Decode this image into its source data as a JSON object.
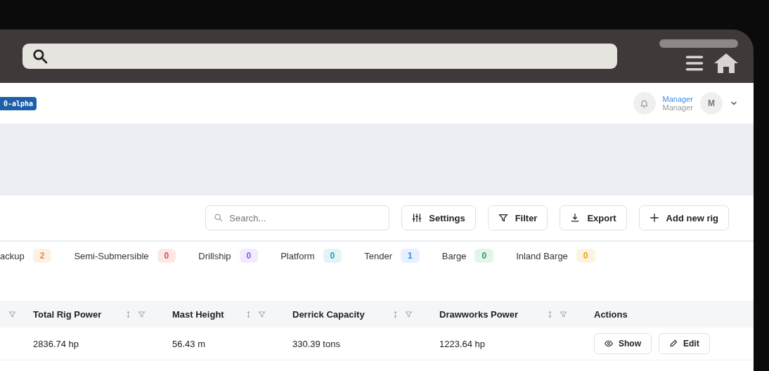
{
  "header": {
    "version_badge": "0-alpha",
    "user_name": "Manager",
    "user_role": "Manager",
    "avatar": "M"
  },
  "toolbar": {
    "search": {
      "placeholder": "Search..."
    },
    "buttons": [
      {
        "kind": "settings",
        "label": "Settings"
      },
      {
        "kind": "filter",
        "label": "Filter"
      },
      {
        "kind": "export",
        "label": "Export"
      },
      {
        "kind": "add",
        "label": "Add new rig"
      }
    ]
  },
  "tabs": [
    {
      "label": "ackup",
      "count": "2",
      "color": "#f08c2e"
    },
    {
      "label": "Semi-Submersible",
      "count": "0",
      "color": "#ef4444"
    },
    {
      "label": "Drillship",
      "count": "0",
      "color": "#8b5cf6"
    },
    {
      "label": "Platform",
      "count": "0",
      "color": "#14a3b8"
    },
    {
      "label": "Tender",
      "count": "1",
      "color": "#3b82f6"
    },
    {
      "label": "Barge",
      "count": "0",
      "color": "#22a355"
    },
    {
      "label": "Inland Barge",
      "count": "0",
      "color": "#e5a50a"
    }
  ],
  "table": {
    "columns": [
      {
        "kind": "filter"
      },
      {
        "label": "Total Rig Power",
        "kind": "sortable"
      },
      {
        "label": "Mast Height",
        "kind": "sortable"
      },
      {
        "label": "Derrick Capacity",
        "kind": "sortable"
      },
      {
        "label": "Drawworks Power",
        "kind": "sortable"
      },
      {
        "label": "Actions",
        "kind": "plain"
      }
    ],
    "rows": [
      {
        "cells": [
          "",
          "2836.74 hp",
          "56.43 m",
          "330.39 tons",
          "1223.64 hp"
        ],
        "actions": [
          "Show",
          "Edit"
        ]
      }
    ]
  }
}
